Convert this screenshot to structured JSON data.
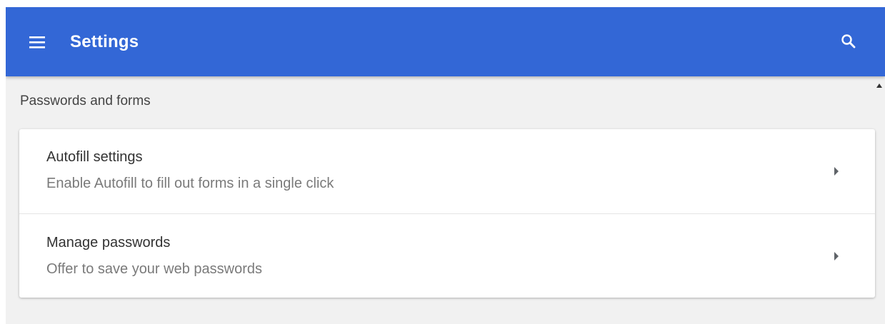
{
  "header": {
    "title": "Settings",
    "menu_icon": "hamburger-menu-icon",
    "search_icon": "search-icon",
    "background_color": "#3367d6"
  },
  "section": {
    "title": "Passwords and forms"
  },
  "items": [
    {
      "label": "Autofill settings",
      "description": "Enable Autofill to fill out forms in a single click",
      "icon": "chevron-right-icon"
    },
    {
      "label": "Manage passwords",
      "description": "Offer to save your web passwords",
      "icon": "chevron-right-icon"
    }
  ]
}
